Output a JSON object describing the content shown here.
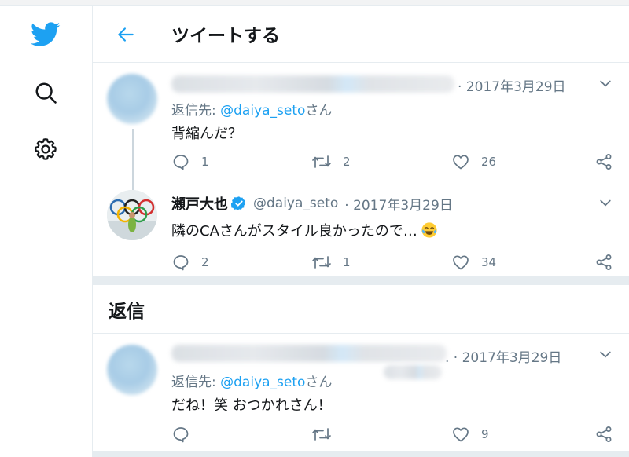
{
  "header": {
    "title": "ツイートする"
  },
  "sidebar": {
    "items": [
      {
        "icon": "twitter-bird-icon"
      },
      {
        "icon": "search-icon"
      },
      {
        "icon": "gear-icon"
      }
    ]
  },
  "tweets": [
    {
      "date": "· 2017年3月29日",
      "reply_prefix": "返信先: ",
      "reply_mention": "@daiya_seto",
      "reply_suffix": "さん",
      "text": "背縮んだ？",
      "replies": "1",
      "retweets": "2",
      "likes": "26"
    },
    {
      "display_name": "瀬戸大也",
      "handle": "@daiya_seto",
      "date": "· 2017年3月29日",
      "text": "隣のCAさんがスタイル良かったので…",
      "replies": "2",
      "retweets": "1",
      "likes": "34"
    }
  ],
  "replies_section": {
    "title": "返信"
  },
  "reply_tweet": {
    "date": ". · 2017年3月29日",
    "reply_prefix": "返信先: ",
    "reply_mention": "@daiya_seto",
    "reply_suffix": "さん",
    "text": "だね！笑 おつかれさん！",
    "replies": "",
    "retweets": "",
    "likes": "9"
  },
  "colors": {
    "accent": "#1da1f2",
    "muted": "#657786",
    "border": "#e6ecf0"
  }
}
